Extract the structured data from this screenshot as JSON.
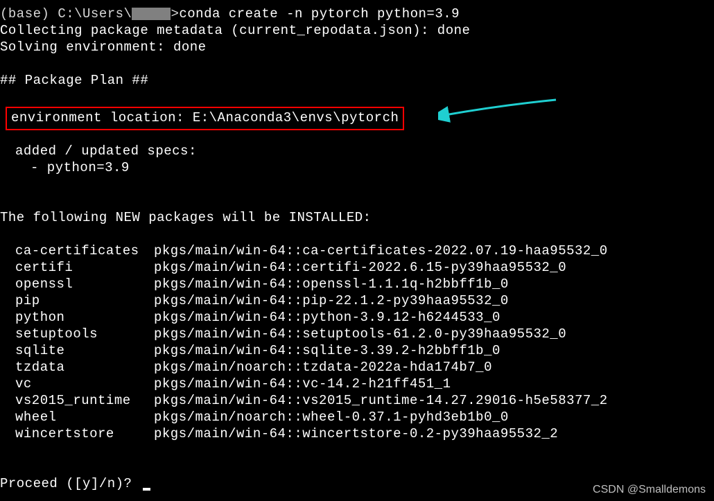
{
  "prompt": {
    "env": "(base)",
    "path_prefix": " C:\\Users\\",
    "path_suffix": ">",
    "command": "conda create -n pytorch python=3.9"
  },
  "collecting_line": "Collecting package metadata (current_repodata.json): done",
  "solving_line": "Solving environment: done",
  "plan_header": "## Package Plan ##",
  "env_location": "environment location: E:\\Anaconda3\\envs\\pytorch",
  "specs_header": "added / updated specs:",
  "spec_item": "- python=3.9",
  "new_packages_header": "The following NEW packages will be INSTALLED:",
  "packages": [
    {
      "name": "ca-certificates",
      "source": "pkgs/main/win-64::ca-certificates-2022.07.19-haa95532_0"
    },
    {
      "name": "certifi",
      "source": "pkgs/main/win-64::certifi-2022.6.15-py39haa95532_0"
    },
    {
      "name": "openssl",
      "source": "pkgs/main/win-64::openssl-1.1.1q-h2bbff1b_0"
    },
    {
      "name": "pip",
      "source": "pkgs/main/win-64::pip-22.1.2-py39haa95532_0"
    },
    {
      "name": "python",
      "source": "pkgs/main/win-64::python-3.9.12-h6244533_0"
    },
    {
      "name": "setuptools",
      "source": "pkgs/main/win-64::setuptools-61.2.0-py39haa95532_0"
    },
    {
      "name": "sqlite",
      "source": "pkgs/main/win-64::sqlite-3.39.2-h2bbff1b_0"
    },
    {
      "name": "tzdata",
      "source": "pkgs/main/noarch::tzdata-2022a-hda174b7_0"
    },
    {
      "name": "vc",
      "source": "pkgs/main/win-64::vc-14.2-h21ff451_1"
    },
    {
      "name": "vs2015_runtime",
      "source": "pkgs/main/win-64::vs2015_runtime-14.27.29016-h5e58377_2"
    },
    {
      "name": "wheel",
      "source": "pkgs/main/noarch::wheel-0.37.1-pyhd3eb1b0_0"
    },
    {
      "name": "wincertstore",
      "source": "pkgs/main/win-64::wincertstore-0.2-py39haa95532_2"
    }
  ],
  "proceed_prompt": "Proceed ([y]/n)? ",
  "watermark": "CSDN @Smalldemons",
  "colors": {
    "highlight_border": "#ff0000",
    "arrow": "#1fcfd1"
  }
}
